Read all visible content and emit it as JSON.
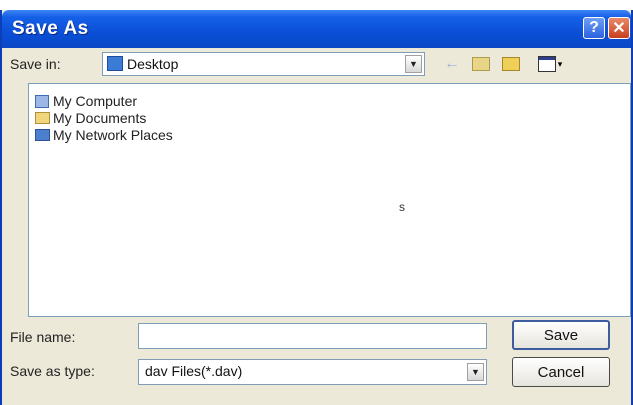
{
  "window": {
    "title": "Save As"
  },
  "titlebar_buttons": {
    "help": "?",
    "close": "✕"
  },
  "save_in": {
    "label": "Save in:",
    "value": "Desktop"
  },
  "toolbar": {
    "back_icon": "←",
    "up_icon": "▦",
    "new_folder_icon": "☆",
    "views_icon": "▦▾"
  },
  "places": [
    {
      "label": "My Computer",
      "icon": "computer-icon"
    },
    {
      "label": "My Documents",
      "icon": "folder-icon"
    },
    {
      "label": "My Network Places",
      "icon": "network-icon"
    }
  ],
  "stray_mark": "s",
  "file_name": {
    "label": "File name:",
    "value": ""
  },
  "save_as_type": {
    "label": "Save as type:",
    "value": "dav Files(*.dav)"
  },
  "buttons": {
    "save": "Save",
    "cancel": "Cancel"
  }
}
